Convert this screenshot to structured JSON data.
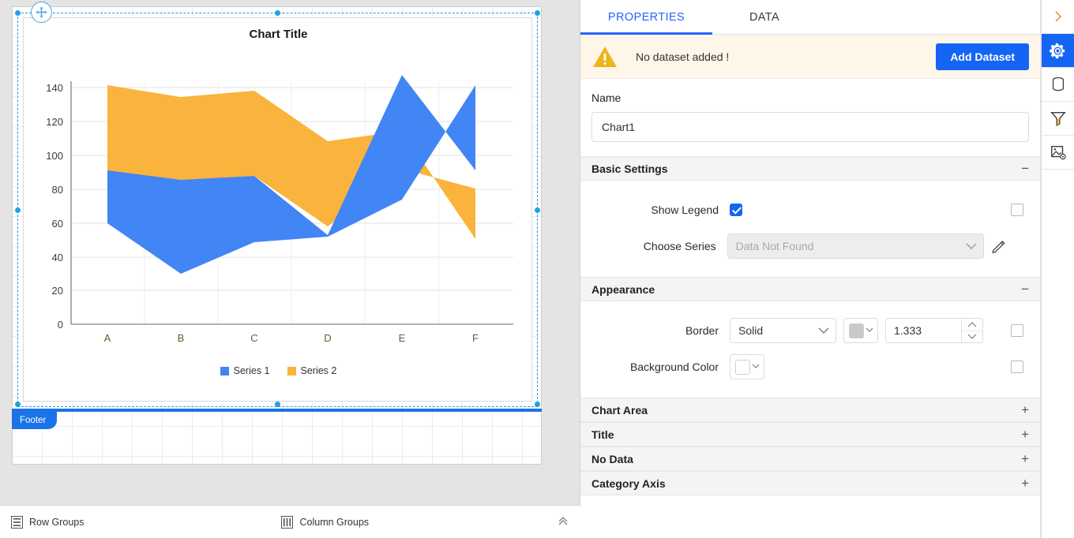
{
  "designer": {
    "footer_label": "Footer",
    "bottom_bar": {
      "row_groups": "Row Groups",
      "column_groups": "Column Groups",
      "collapse_icon": "chevron-double-up-icon"
    }
  },
  "chart_data": {
    "type": "area",
    "title": "Chart Title",
    "xlabel": "",
    "ylabel": "",
    "categories": [
      "A",
      "B",
      "C",
      "D",
      "E",
      "F"
    ],
    "ylim": [
      0,
      150
    ],
    "yticks": [
      0,
      20,
      40,
      60,
      80,
      100,
      120,
      140
    ],
    "grid": true,
    "legend_position": "bottom",
    "colors": {
      "series1": "#4285f4",
      "series2": "#fab33c"
    },
    "series": [
      {
        "name": "Series 1",
        "values": [
          92,
          86,
          88,
          53,
          148,
          92
        ],
        "lower": [
          60,
          30,
          49,
          52,
          74,
          142
        ]
      },
      {
        "name": "Series 2",
        "values": [
          142,
          135,
          138,
          108,
          144,
          80
        ],
        "lower": [
          92,
          85,
          88,
          58,
          92,
          31
        ]
      }
    ]
  },
  "panel": {
    "tabs": [
      {
        "label": "PROPERTIES",
        "active": true
      },
      {
        "label": "DATA",
        "active": false
      }
    ],
    "alert": {
      "icon": "warning-triangle-icon",
      "message": "No dataset added !",
      "action_label": "Add Dataset"
    },
    "name_field": {
      "label": "Name",
      "value": "Chart1"
    },
    "sections": [
      {
        "title": "Basic Settings",
        "toggle": "−",
        "expanded": true,
        "rows": {
          "show_legend": {
            "label": "Show Legend",
            "checked": true,
            "expression_checked": false
          },
          "choose_series": {
            "label": "Choose Series",
            "value": "Data Not Found",
            "disabled": true,
            "edit_icon": "pencil-icon"
          }
        }
      },
      {
        "title": "Appearance",
        "toggle": "−",
        "expanded": true,
        "rows": {
          "border": {
            "label": "Border",
            "style": "Solid",
            "color": "#c9c9c9",
            "width": "1.333",
            "expression_checked": false
          },
          "background_color": {
            "label": "Background Color",
            "color": "#ffffff",
            "expression_checked": false
          }
        }
      }
    ],
    "collapsed_sections": [
      {
        "title": "Chart Area",
        "toggle": "+"
      },
      {
        "title": "Title",
        "toggle": "+"
      },
      {
        "title": "No Data",
        "toggle": "+"
      },
      {
        "title": "Category Axis",
        "toggle": "+"
      }
    ],
    "rail": [
      {
        "icon": "chevron-right-icon",
        "active": false
      },
      {
        "icon": "gear-icon",
        "active": true
      },
      {
        "icon": "database-icon",
        "active": false
      },
      {
        "icon": "filter-funnel-icon",
        "active": false
      },
      {
        "icon": "image-settings-icon",
        "active": false
      }
    ]
  }
}
